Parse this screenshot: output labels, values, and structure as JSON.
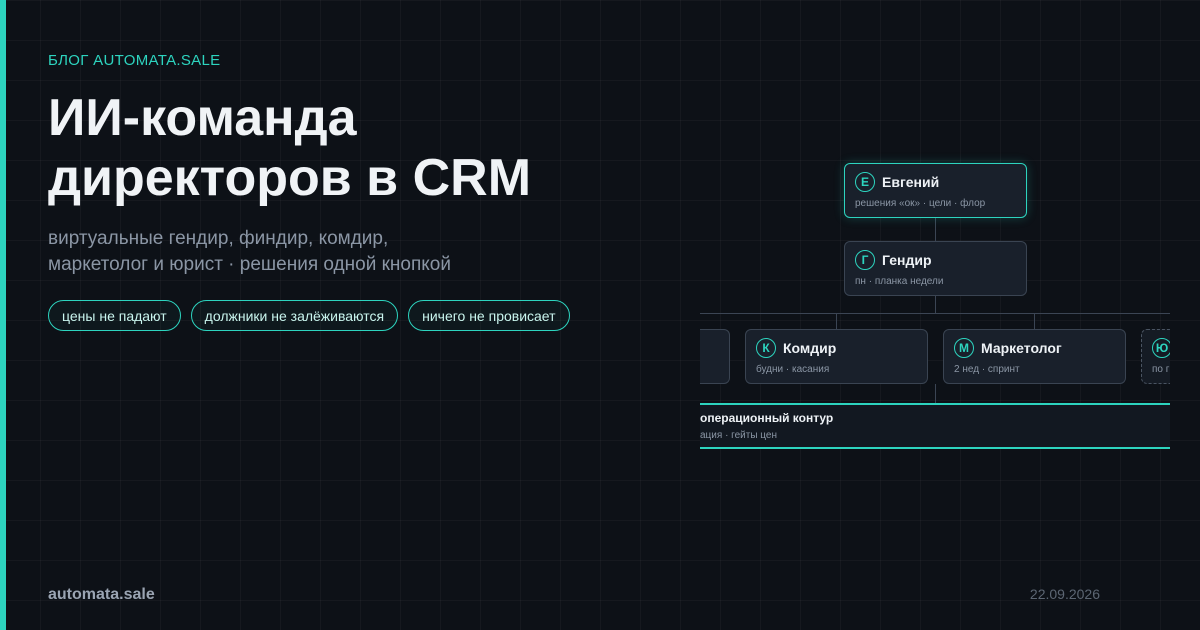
{
  "blog": {
    "eyebrow": "БЛОГ AUTOMATA.SALE",
    "title_lines": [
      "ИИ-команда",
      "директоров в CRM"
    ],
    "subtitle_lines": [
      "виртуальные гендир, финдир, комдир,",
      "маркетолог и юрист · решения одной кнопкой"
    ],
    "tags": [
      "цены не падают",
      "должники не залёживаются",
      "ничего не провисает"
    ],
    "site": "automata.sale",
    "date": "22.09.2026"
  },
  "org": {
    "top": {
      "initial": "Е",
      "title": "Евгений",
      "desc": "решения «ок» · цели · флор"
    },
    "ceo": {
      "initial": "Г",
      "title": "Гендир",
      "desc": "пн · планка недели"
    },
    "reports": [
      {
        "initial": "К",
        "title": "Комдир",
        "desc": "будни · касания"
      },
      {
        "initial": "М",
        "title": "Маркетолог",
        "desc": "2 нед · спринт"
      },
      {
        "initial": "Ю",
        "title": "",
        "desc": "по г"
      }
    ],
    "contour": {
      "title": "операционный контур",
      "desc": "ация · гейты цен"
    }
  },
  "colors": {
    "accent": "#2dd4bf",
    "background": "#0d1117"
  }
}
